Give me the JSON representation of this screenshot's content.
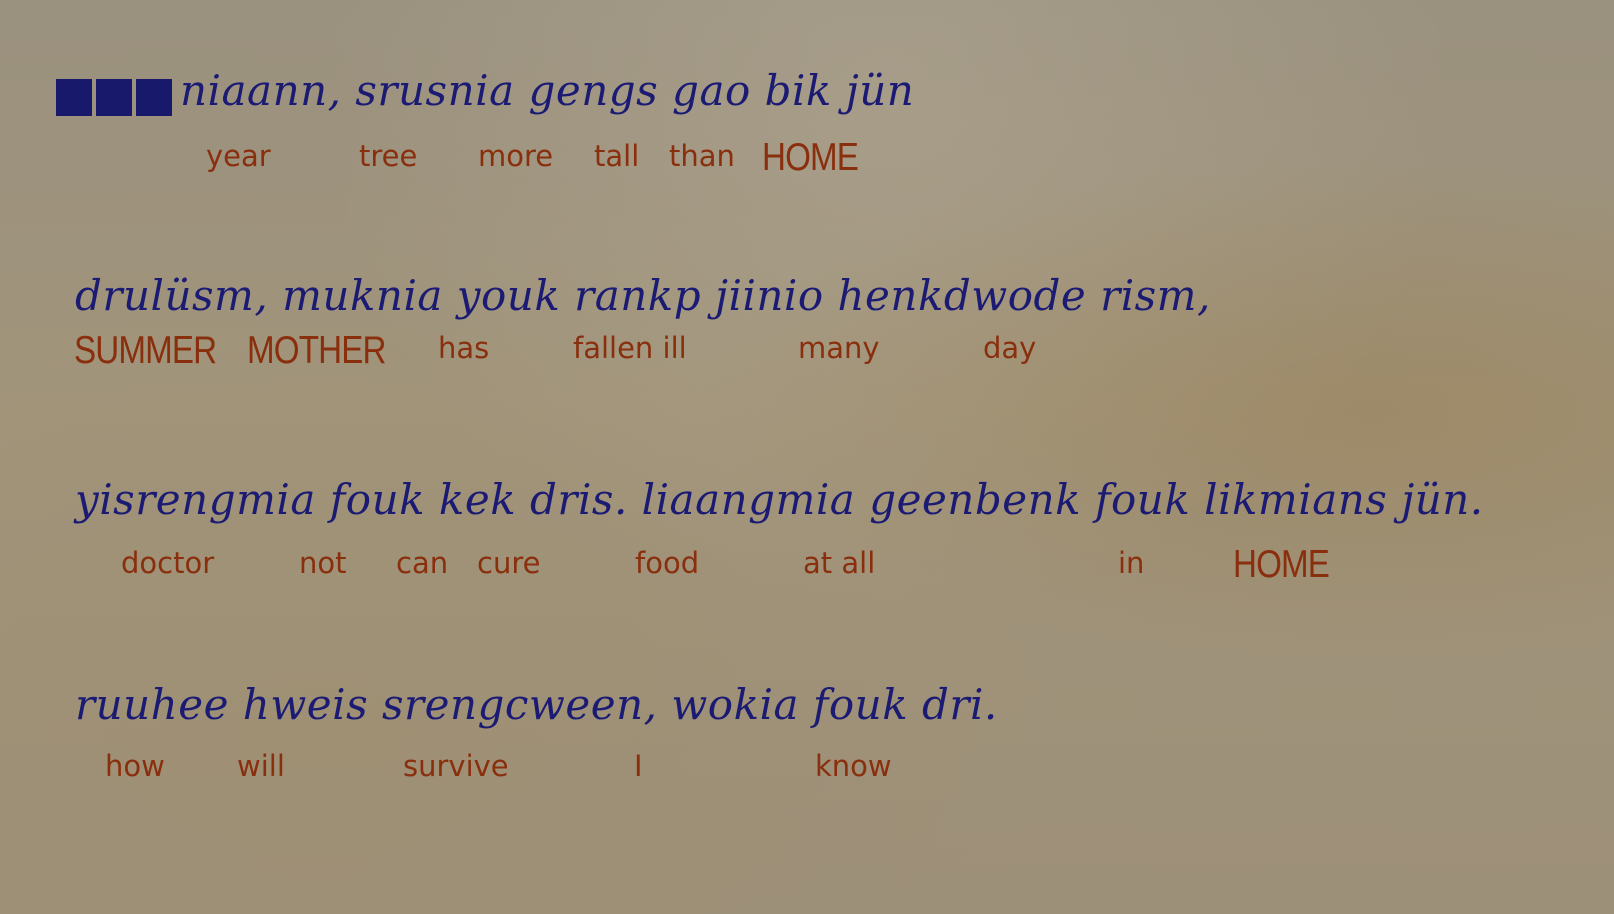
{
  "lines": [
    {
      "text": "niaann, srusnia gengs gao bik jün",
      "gloss": [
        "year",
        "tree",
        "more",
        "tall",
        "than",
        "HOME"
      ]
    },
    {
      "text": "drulüsm, muknia youk rankp jiinio henkdwode rism,",
      "gloss": [
        "SUMMER",
        "MOTHER",
        "has",
        "fallen ill",
        "many",
        "day"
      ]
    },
    {
      "text": "yisrengmia fouk kek dris. liaangmia geenbenk fouk likmians jün.",
      "gloss": [
        "doctor",
        "not",
        "can",
        "cure",
        "food",
        "at all",
        "in",
        "HOME"
      ]
    },
    {
      "text": "ruuhee hweis srengcween, wokia fouk dri.",
      "gloss": [
        "how",
        "will",
        "survive",
        "I",
        "know"
      ]
    }
  ],
  "colors": {
    "script_text": "#1b1b74",
    "gloss_text": "#8a2f0d",
    "redaction_blocks": "#18196b"
  }
}
